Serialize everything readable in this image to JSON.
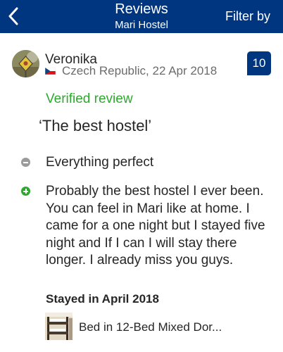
{
  "header": {
    "title": "Reviews",
    "subtitle": "Mari Hostel",
    "filter_label": "Filter by",
    "background": "#003580"
  },
  "review": {
    "reviewer": {
      "name": "Veronika",
      "country": "Czech Republic",
      "date": "22 Apr 2018",
      "meta": "Czech Republic, 22 Apr 2018",
      "flag_icon": "czech-flag-icon",
      "avatar_icon": "avatar-photo"
    },
    "score": "10",
    "verified_label": "Verified review",
    "title": "‘The best hostel’",
    "negative": "Everything perfect",
    "positive": "Probably the best hostel I ever been. You can feel in Mari like at home. I came for a one night but I stayed five night and If I can I will stay there longer. I already miss you guys.",
    "stayed": "Stayed in April 2018",
    "room": "Bed in 12-Bed Mixed Dor..."
  },
  "colors": {
    "accent": "#003580",
    "positive": "#2ea82e",
    "negative": "#9b9b9b"
  }
}
